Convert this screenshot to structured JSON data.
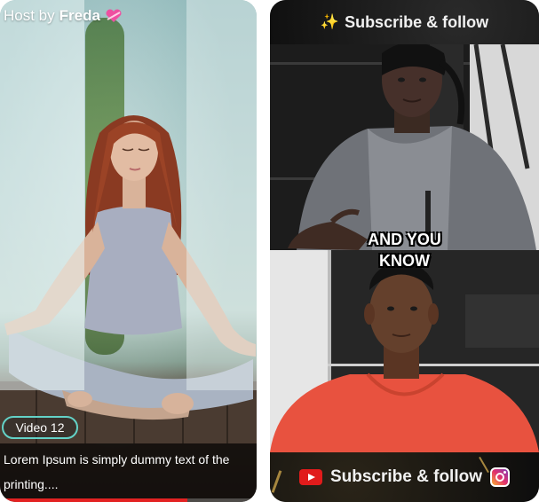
{
  "left_card": {
    "host_prefix": "Host by",
    "host_name": "Freda",
    "video_badge": "Video 12",
    "caption_text": "Lorem Ipsum is simply dummy text of the printing....",
    "progress": 0.73,
    "progress_color": "#e32222",
    "accent_color": "#63d2c7"
  },
  "right_card": {
    "top_banner": {
      "icon": "sparkle-icon",
      "text": "Subscribe & follow"
    },
    "overlay_caption": {
      "line1": "AND YOU",
      "line2": "KNOW"
    },
    "bottom_banner": {
      "left_icon": "youtube-icon",
      "text": "Subscribe & follow",
      "right_icon": "instagram-icon"
    }
  }
}
